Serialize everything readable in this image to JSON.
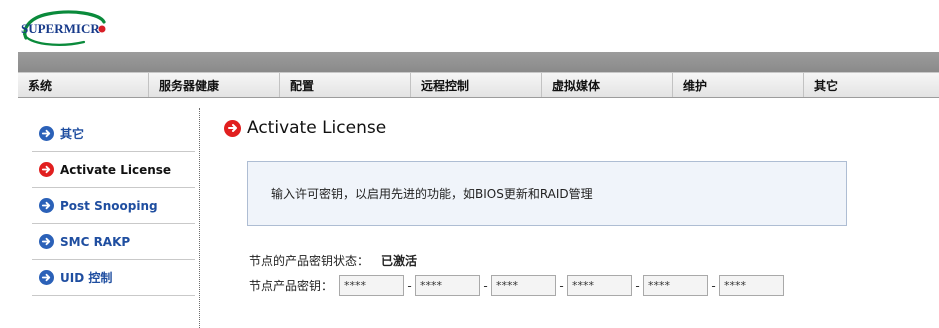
{
  "logo": {
    "text": "SUPERMICR",
    "accent_color": "#d81f26",
    "brand_color": "#0a8a3b"
  },
  "nav": {
    "items": [
      "系统",
      "服务器健康",
      "配置",
      "远程控制",
      "虚拟媒体",
      "维护",
      "其它"
    ]
  },
  "sidebar": {
    "items": [
      {
        "label": "其它",
        "icon": "arrow-right-blue-icon",
        "active": false
      },
      {
        "label": "Activate License",
        "icon": "arrow-right-red-icon",
        "active": true
      },
      {
        "label": "Post Snooping",
        "icon": "arrow-right-blue-icon",
        "active": false
      },
      {
        "label": "SMC RAKP",
        "icon": "arrow-right-blue-icon",
        "active": false
      },
      {
        "label": "UID 控制",
        "icon": "arrow-right-blue-icon",
        "active": false
      }
    ]
  },
  "main": {
    "title": "Activate License",
    "info": "输入许可密钥，以启用先进的功能，如BIOS更新和RAID管理",
    "status_label": "节点的产品密钥状态：",
    "status_value": "已激活",
    "key_label": "节点产品密钥：",
    "key_fields": [
      "****",
      "****",
      "****",
      "****",
      "****",
      "****"
    ]
  },
  "colors": {
    "link_blue": "#1f4ea0",
    "active_red": "#e11f1f",
    "icon_blue": "#2b61b8"
  }
}
